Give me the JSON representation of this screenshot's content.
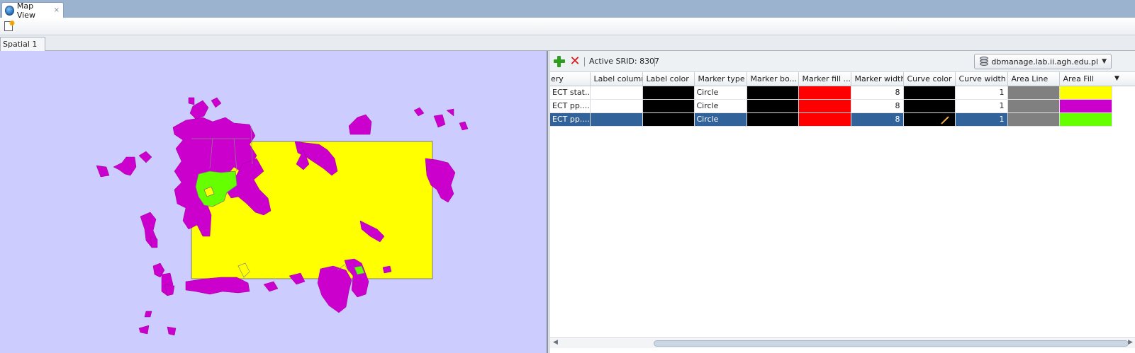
{
  "window": {
    "tab_title": "Map View",
    "close_glyph": "×",
    "icon": "globe-icon"
  },
  "toolbar": {
    "new_icon": "new-document-icon"
  },
  "view_tabs": [
    {
      "label": "Spatial 1"
    }
  ],
  "map": {
    "background": "#ccccff",
    "colors": {
      "yellow": "#ffff00",
      "magenta": "#cc00cc",
      "green": "#66ff00",
      "outline": "#7a7a7a"
    }
  },
  "layer_panel": {
    "add_icon": "add-icon",
    "delete_icon": "delete-icon",
    "active_srid": "Active SRID: 8307",
    "connection": "dbmanage.lab.ii.agh.edu.pl",
    "columns": [
      "ery",
      "Label column",
      "Label color",
      "Marker type",
      "Marker bo...",
      "Marker fill ...",
      "Marker width",
      "Curve color",
      "Curve width",
      "Area Line",
      "Area Fill"
    ],
    "rows": [
      {
        "query": "ECT stat...",
        "label_column": "",
        "label_color": "#000000",
        "marker_type": "Circle",
        "marker_border": "#000000",
        "marker_fill": "#ff0000",
        "marker_width": "8",
        "curve_color": "#000000",
        "curve_width": "1",
        "area_line": "#808080",
        "area_fill": "#ffff00",
        "selected": false
      },
      {
        "query": "ECT pp....",
        "label_column": "",
        "label_color": "#000000",
        "marker_type": "Circle",
        "marker_border": "#000000",
        "marker_fill": "#ff0000",
        "marker_width": "8",
        "curve_color": "#000000",
        "curve_width": "1",
        "area_line": "#808080",
        "area_fill": "#cc00cc",
        "selected": false
      },
      {
        "query": "ECT pp....",
        "label_column": "",
        "label_color": "#000000",
        "marker_type": "Circle",
        "marker_border": "#000000",
        "marker_fill": "#ff0000",
        "marker_width": "8",
        "curve_color": "#000000",
        "curve_width": "1",
        "area_line": "#808080",
        "area_fill": "#66ff00",
        "selected": true
      }
    ]
  }
}
